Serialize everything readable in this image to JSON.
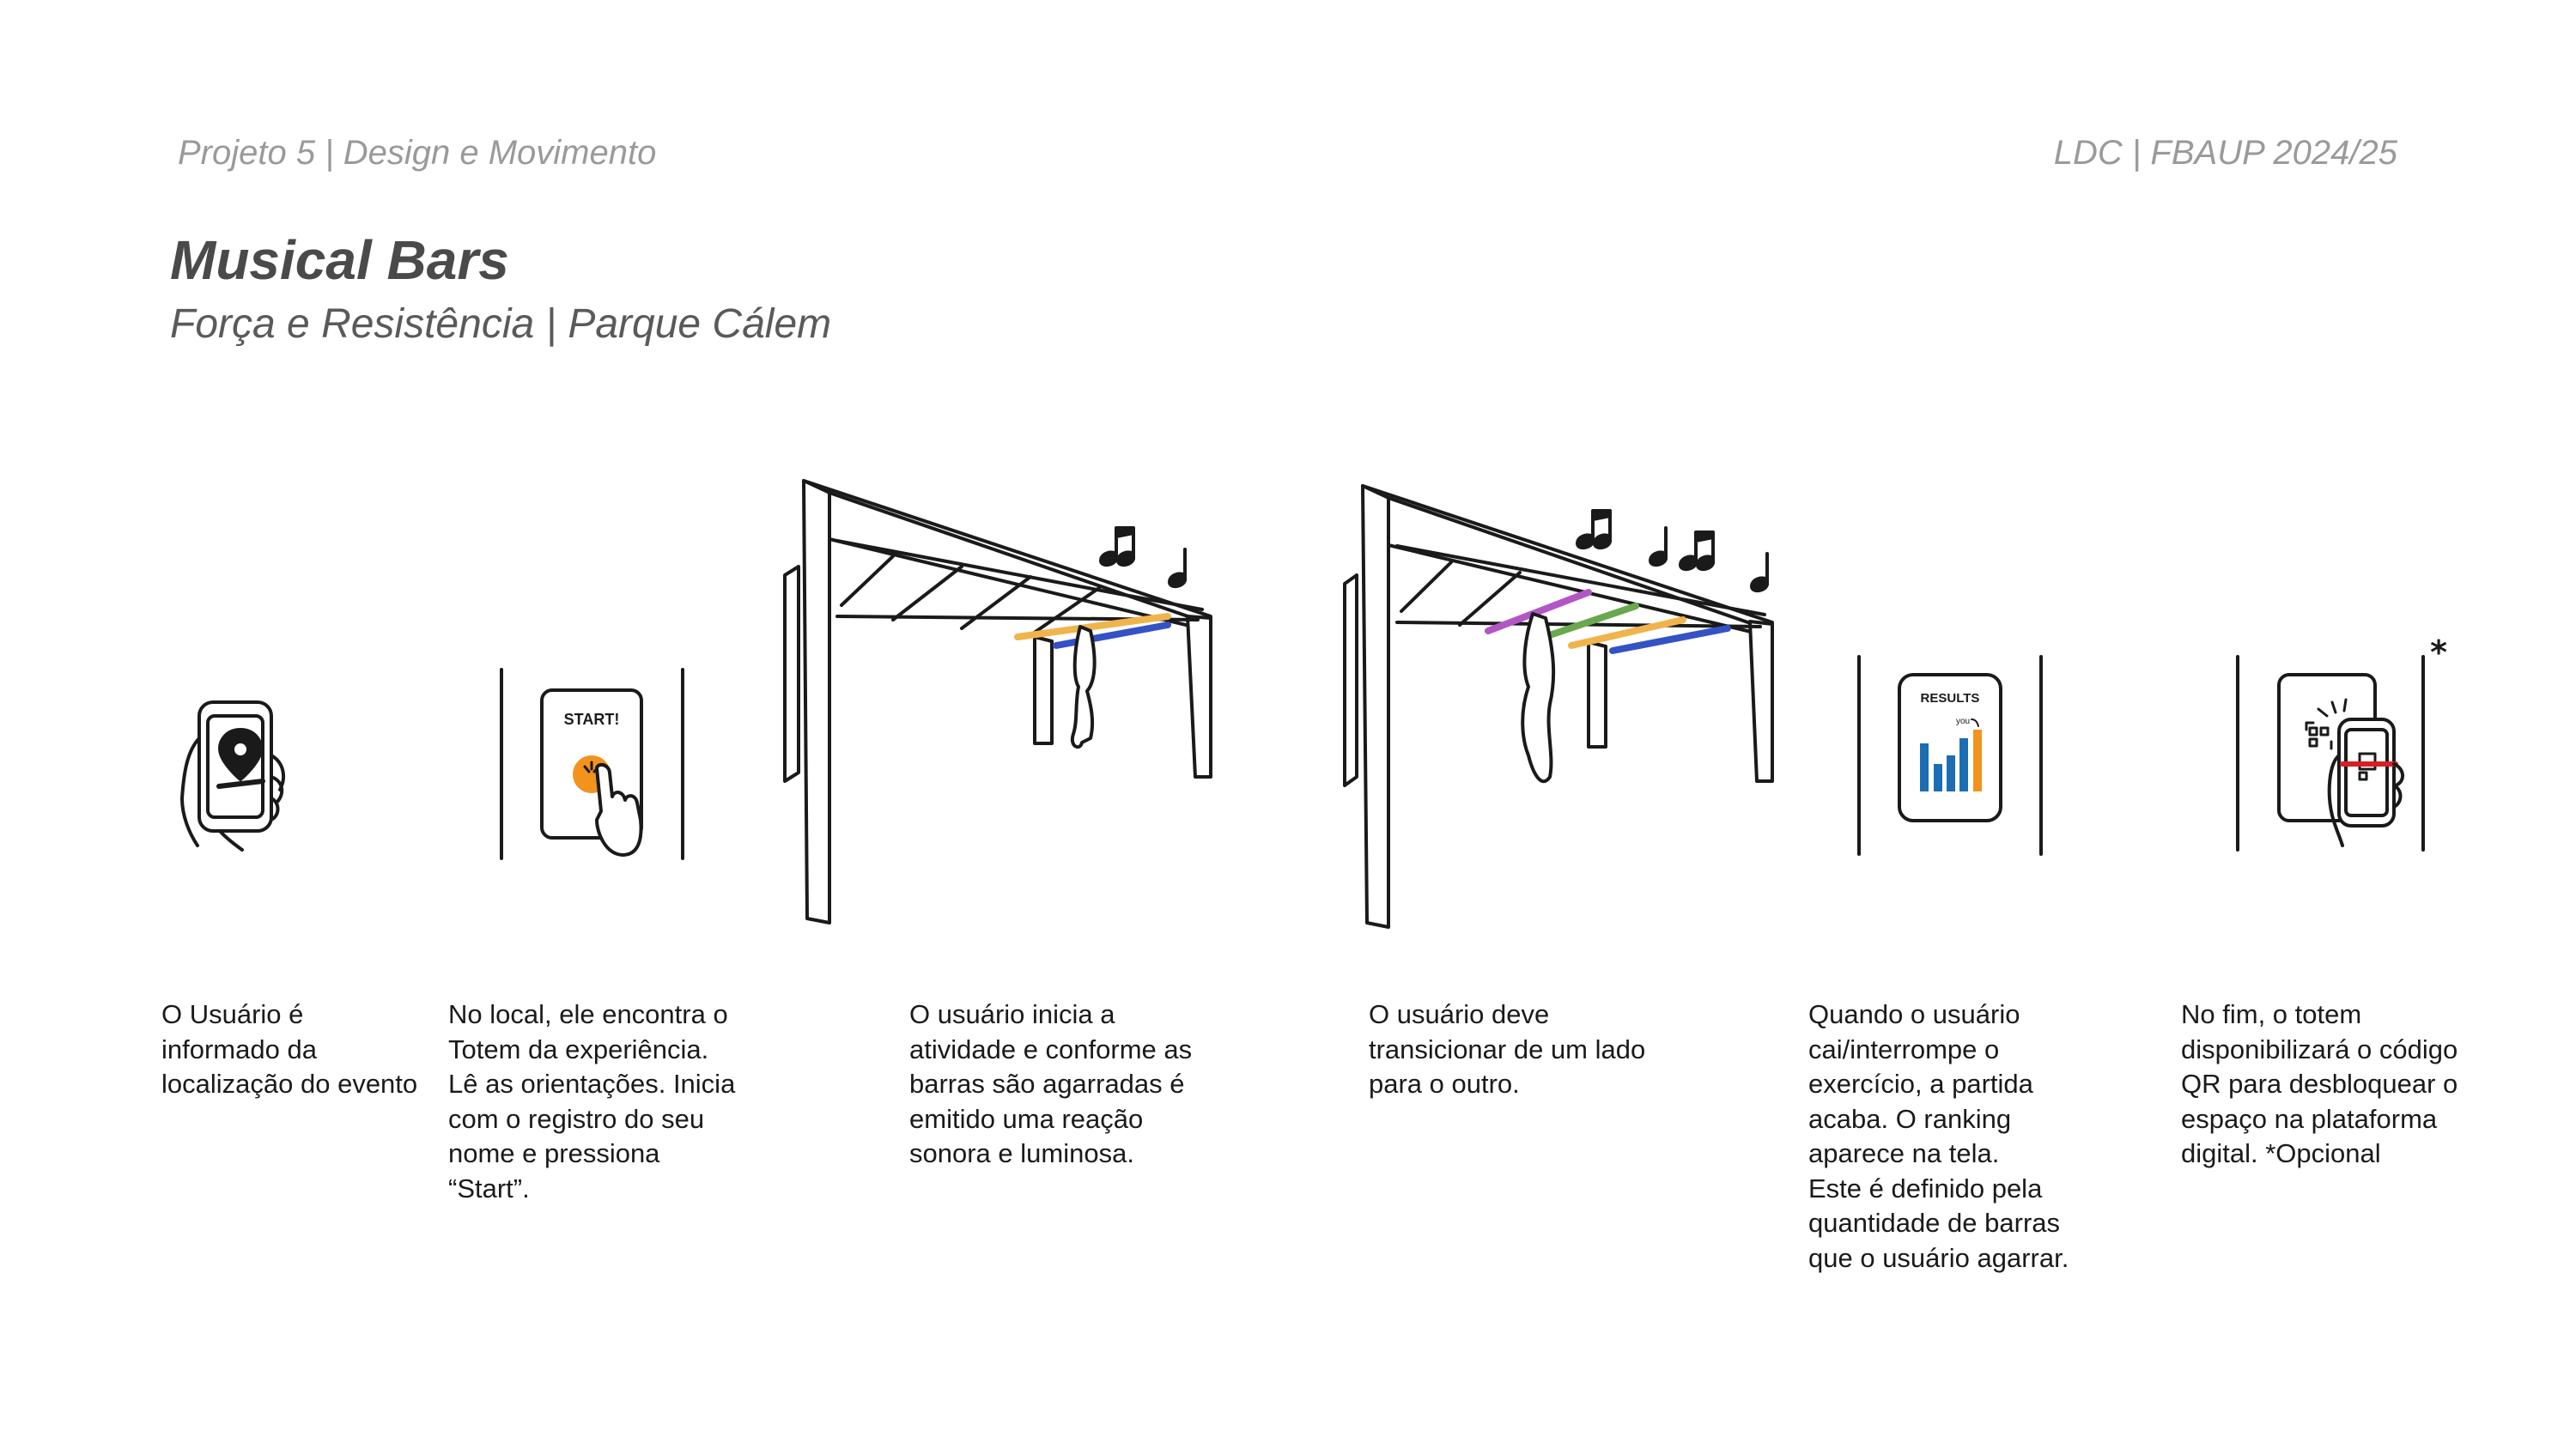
{
  "header": {
    "left": "Projeto 5 | Design e Movimento",
    "right": "LDC | FBAUP 2024/25"
  },
  "title": "Musical Bars",
  "subtitle": "Força e Resistência | Parque Cálem",
  "icons": {
    "start_label": "START!",
    "results_label": "RESULTS",
    "results_you": "you",
    "optional_marker": "*"
  },
  "colors": {
    "orange": "#F2931E",
    "blue": "#1B6EB3",
    "purple": "#B256C6",
    "green": "#6AA84F",
    "light_orange": "#F0B44C",
    "dark_blue": "#3352C4",
    "red": "#D81F26"
  },
  "steps": [
    {
      "lines": [
        "O Usuário é",
        "informado da",
        "localização do evento"
      ]
    },
    {
      "lines": [
        "No local, ele encontra o",
        "Totem da experiência.",
        "Lê as orientações. Inicia",
        "com o registro do seu",
        "nome e pressiona",
        "“Start”."
      ]
    },
    {
      "lines": [
        "O usuário inicia a",
        "atividade e conforme as",
        "barras são agarradas é",
        "emitido uma reação",
        "sonora e luminosa."
      ]
    },
    {
      "lines": [
        "O usuário deve",
        "transicionar de um lado",
        "para o outro."
      ]
    },
    {
      "lines": [
        "Quando o usuário",
        "cai/interrompe o",
        "exercício, a partida",
        "acaba. O ranking",
        "aparece na tela.",
        "Este é definido pela",
        "quantidade de barras",
        "que o usuário agarrar."
      ]
    },
    {
      "lines": [
        "No fim, o totem",
        "disponibilizará o código",
        "QR para desbloquear o",
        "espaço na plataforma",
        "digital. *Opcional"
      ]
    }
  ]
}
